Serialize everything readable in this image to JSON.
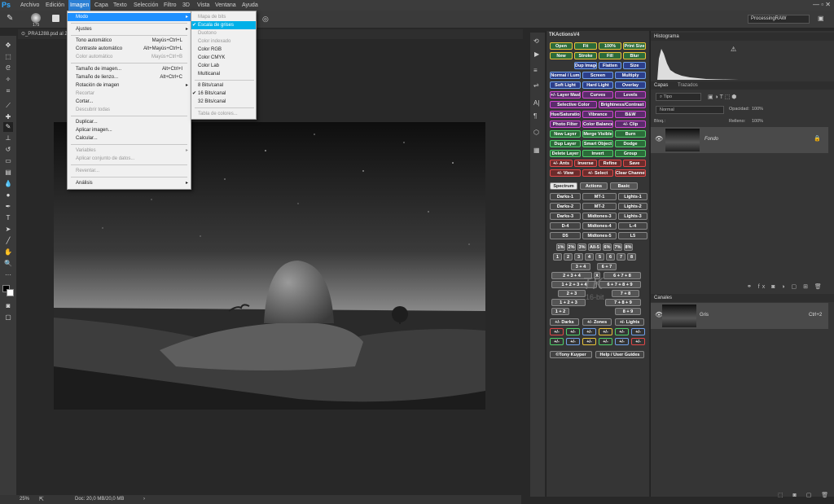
{
  "app": {
    "logo": "Ps"
  },
  "menubar": {
    "items": [
      "Archivo",
      "Edición",
      "Imagen",
      "Capa",
      "Texto",
      "Selección",
      "Filtro",
      "3D",
      "Vista",
      "Ventana",
      "Ayuda"
    ],
    "active": "Imagen"
  },
  "options": {
    "brush_size": "175",
    "workspace": "ProcessingRAW"
  },
  "document": {
    "tab_title": "⊙_PRA1288.psd al 25% (Gris/16)",
    "zoom": "25%",
    "doc_info": "Doc: 20,0 MB/20,0 MB"
  },
  "image_menu": {
    "items": [
      {
        "label": "Modo",
        "shortcut": "",
        "submenu": true,
        "disabled": false,
        "highlight": true
      },
      {
        "label": "Ajustes",
        "shortcut": "",
        "submenu": true,
        "disabled": false
      },
      {
        "label": "Tono automático",
        "shortcut": "Mayús+Ctrl+L",
        "disabled": false
      },
      {
        "label": "Contraste automático",
        "shortcut": "Alt+Mayús+Ctrl+L",
        "disabled": false
      },
      {
        "label": "Color automático",
        "shortcut": "Mayús+Ctrl+B",
        "disabled": true
      },
      {
        "label": "Tamaño de imagen...",
        "shortcut": "Alt+Ctrl+I",
        "disabled": false
      },
      {
        "label": "Tamaño de lienzo...",
        "shortcut": "Alt+Ctrl+C",
        "disabled": false
      },
      {
        "label": "Rotación de imagen",
        "shortcut": "",
        "submenu": true,
        "disabled": false
      },
      {
        "label": "Recortar",
        "shortcut": "",
        "disabled": true
      },
      {
        "label": "Cortar...",
        "shortcut": "",
        "disabled": false
      },
      {
        "label": "Descubrir todas",
        "shortcut": "",
        "disabled": true
      },
      {
        "label": "Duplicar...",
        "shortcut": "",
        "disabled": false
      },
      {
        "label": "Aplicar imagen...",
        "shortcut": "",
        "disabled": false
      },
      {
        "label": "Calcular...",
        "shortcut": "",
        "disabled": false
      },
      {
        "label": "Variables",
        "shortcut": "",
        "submenu": true,
        "disabled": true
      },
      {
        "label": "Aplicar conjunto de datos...",
        "shortcut": "",
        "disabled": true
      },
      {
        "label": "Reventar...",
        "shortcut": "",
        "disabled": true
      },
      {
        "label": "Análisis",
        "shortcut": "",
        "submenu": true,
        "disabled": false
      }
    ]
  },
  "mode_submenu": {
    "items": [
      {
        "label": "Mapa de bits",
        "disabled": true
      },
      {
        "label": "Escala de grises",
        "checked": true,
        "highlight": true
      },
      {
        "label": "Duotono",
        "disabled": true
      },
      {
        "label": "Color indexado",
        "disabled": true
      },
      {
        "label": "Color RGB"
      },
      {
        "label": "Color CMYK"
      },
      {
        "label": "Color Lab"
      },
      {
        "label": "Multicanal"
      },
      {
        "label": "8 Bits/canal"
      },
      {
        "label": "16 Bits/canal",
        "checked": true
      },
      {
        "label": "32 Bits/canal"
      },
      {
        "label": "Tabla de colores...",
        "disabled": true
      }
    ]
  },
  "tk_panel": {
    "title": "TKActionsV4",
    "rows": [
      [
        "Open",
        "Fit",
        "100%",
        "Print Size"
      ],
      [
        "New",
        "Stroke",
        "Fill",
        "Blur"
      ],
      [
        "Dup Image",
        "Flatten",
        "Size"
      ],
      [
        "Normal / Lum",
        "Screen",
        "Multiply"
      ],
      [
        "Soft Light",
        "Hard Light",
        "Overlay"
      ],
      [
        "+/- Layer Mask",
        "Curves",
        "Levels"
      ],
      [
        "Selective Color",
        "Brightness/Contrast"
      ],
      [
        "Hue/Saturation",
        "Vibrance",
        "B&W"
      ],
      [
        "Photo Filter",
        "Color Balance",
        "+/- Clip"
      ],
      [
        "New Layer",
        "Merge Visible",
        "Burn"
      ],
      [
        "Dup Layer",
        "Smart Object",
        "Dodge"
      ],
      [
        "Delete Layer",
        "Invert",
        "Group"
      ],
      [
        "+/- Ants",
        "Inverse",
        "Refine",
        "Save"
      ],
      [
        "+/- View",
        "+/- Select",
        "Clear Channels"
      ]
    ],
    "tabs": [
      "Spectrum",
      "Actions",
      "Basic"
    ],
    "spectrum": [
      [
        "Darks-1",
        "MT-1",
        "Lights-1"
      ],
      [
        "Darks-2",
        "MT-2",
        "Lights-2"
      ],
      [
        "Darks-3",
        "Midtones-3",
        "Lights-3"
      ],
      [
        "D-4",
        "Midtones-4",
        "L-4"
      ],
      [
        "D5",
        "Midtones-5",
        "L5"
      ]
    ],
    "numbers": [
      "1%",
      "2%",
      "3%",
      "All-5",
      "6%",
      "7%",
      "8%"
    ],
    "digits": [
      "1",
      "2",
      "3",
      "4",
      "5",
      "6",
      "7",
      "8"
    ],
    "combos": [
      "3 + 4",
      "6 + 7",
      "2 + 3 + 4",
      "X",
      "6 + 7 + 8",
      "1 + 2 + 3 + 4",
      "6 + 7 + 8 + 9",
      "2 + 3",
      "7 + 8",
      "1 + 2 + 3",
      "7 + 8 + 9",
      "1 + 2",
      "8 + 9"
    ],
    "watermark": "TK",
    "watermark2": "16-bit",
    "zones": [
      "+/- Darks",
      "+/- Zones",
      "+/- Lights"
    ],
    "plusminus": "+/-",
    "footer": [
      "©Tony Kuyper",
      "Help / User Guides"
    ]
  },
  "histogram": {
    "title": "Histograma"
  },
  "layers": {
    "tabs": [
      "Capas",
      "Trazados"
    ],
    "filter": "Tipo",
    "blend": "Normal",
    "opacity_label": "Opacidad:",
    "opacity": "100%",
    "lock_label": "Bloq.:",
    "fill_label": "Relleno:",
    "fill": "100%",
    "layer_name": "Fondo"
  },
  "channels": {
    "title": "Canales",
    "name": "Gris",
    "shortcut": "Ctrl+2"
  },
  "colors": {
    "accent": "#1e90ff",
    "submenu_highlight": "#00b0e8"
  }
}
